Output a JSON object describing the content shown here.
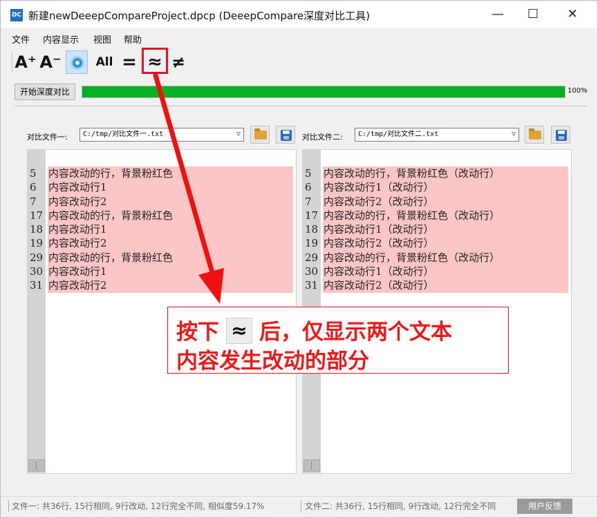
{
  "window": {
    "title": "新建newDeeepCompareProject.dpcp  (DeeepCompare深度对比工具)",
    "logo_text": "DC"
  },
  "window_controls": {
    "minimize": "—",
    "maximize": "☐",
    "close": "✕"
  },
  "menu": [
    "文件",
    "内容显示",
    "视图",
    "帮助"
  ],
  "toolbar": {
    "font_increase": "A⁺",
    "font_decrease": "A⁻",
    "show_all": "All",
    "show_equal": "=",
    "show_changed": "≈",
    "show_different": "≠",
    "selected": "sync-scroll"
  },
  "compare": {
    "start_button": "开始深度对比",
    "progress": 1.0,
    "progress_label": "100%"
  },
  "left": {
    "label": "对比文件一:",
    "path": "C:/tmp/对比文件一.txt",
    "lines": [
      {
        "n": "5",
        "text": "内容改动的行，背景粉红色"
      },
      {
        "n": "6",
        "text": "内容改动行1"
      },
      {
        "n": "7",
        "text": "内容改动行2"
      },
      {
        "n": "17",
        "text": "内容改动的行，背景粉红色"
      },
      {
        "n": "18",
        "text": "内容改动行1"
      },
      {
        "n": "19",
        "text": "内容改动行2"
      },
      {
        "n": "29",
        "text": "内容改动的行，背景粉红色"
      },
      {
        "n": "30",
        "text": "内容改动行1"
      },
      {
        "n": "31",
        "text": "内容改动行2"
      }
    ]
  },
  "right": {
    "label": "对比文件二:",
    "path": "C:/tmp/对比文件二.txt",
    "lines": [
      {
        "n": "5",
        "text": "内容改动的行，背景粉红色（改动行）"
      },
      {
        "n": "6",
        "text": "内容改动行1（改动行）"
      },
      {
        "n": "7",
        "text": "内容改动行2（改动行）"
      },
      {
        "n": "17",
        "text": "内容改动的行，背景粉红色（改动行）"
      },
      {
        "n": "18",
        "text": "内容改动行1（改动行）"
      },
      {
        "n": "19",
        "text": "内容改动行2（改动行）"
      },
      {
        "n": "29",
        "text": "内容改动的行，背景粉红色（改动行）"
      },
      {
        "n": "30",
        "text": "内容改动行1（改动行）"
      },
      {
        "n": "31",
        "text": "内容改动行2（改动行）"
      }
    ]
  },
  "status": {
    "left": "文件一: 共36行, 15行相同, 9行改动, 12行完全不同, 相似度59.17%",
    "right": "文件二: 共36行, 15行相同, 9行改动, 12行完全不同",
    "feedback": "用户反馈"
  },
  "annotation": {
    "prefix": "按下",
    "icon": "≈",
    "suffix": "后，仅显示两个文本",
    "line2": "内容发生改动的部分",
    "color": "#e81123"
  },
  "colors": {
    "changed_bg": "#fcc6c6",
    "progress": "#06b025",
    "accent_red": "#e81123"
  }
}
